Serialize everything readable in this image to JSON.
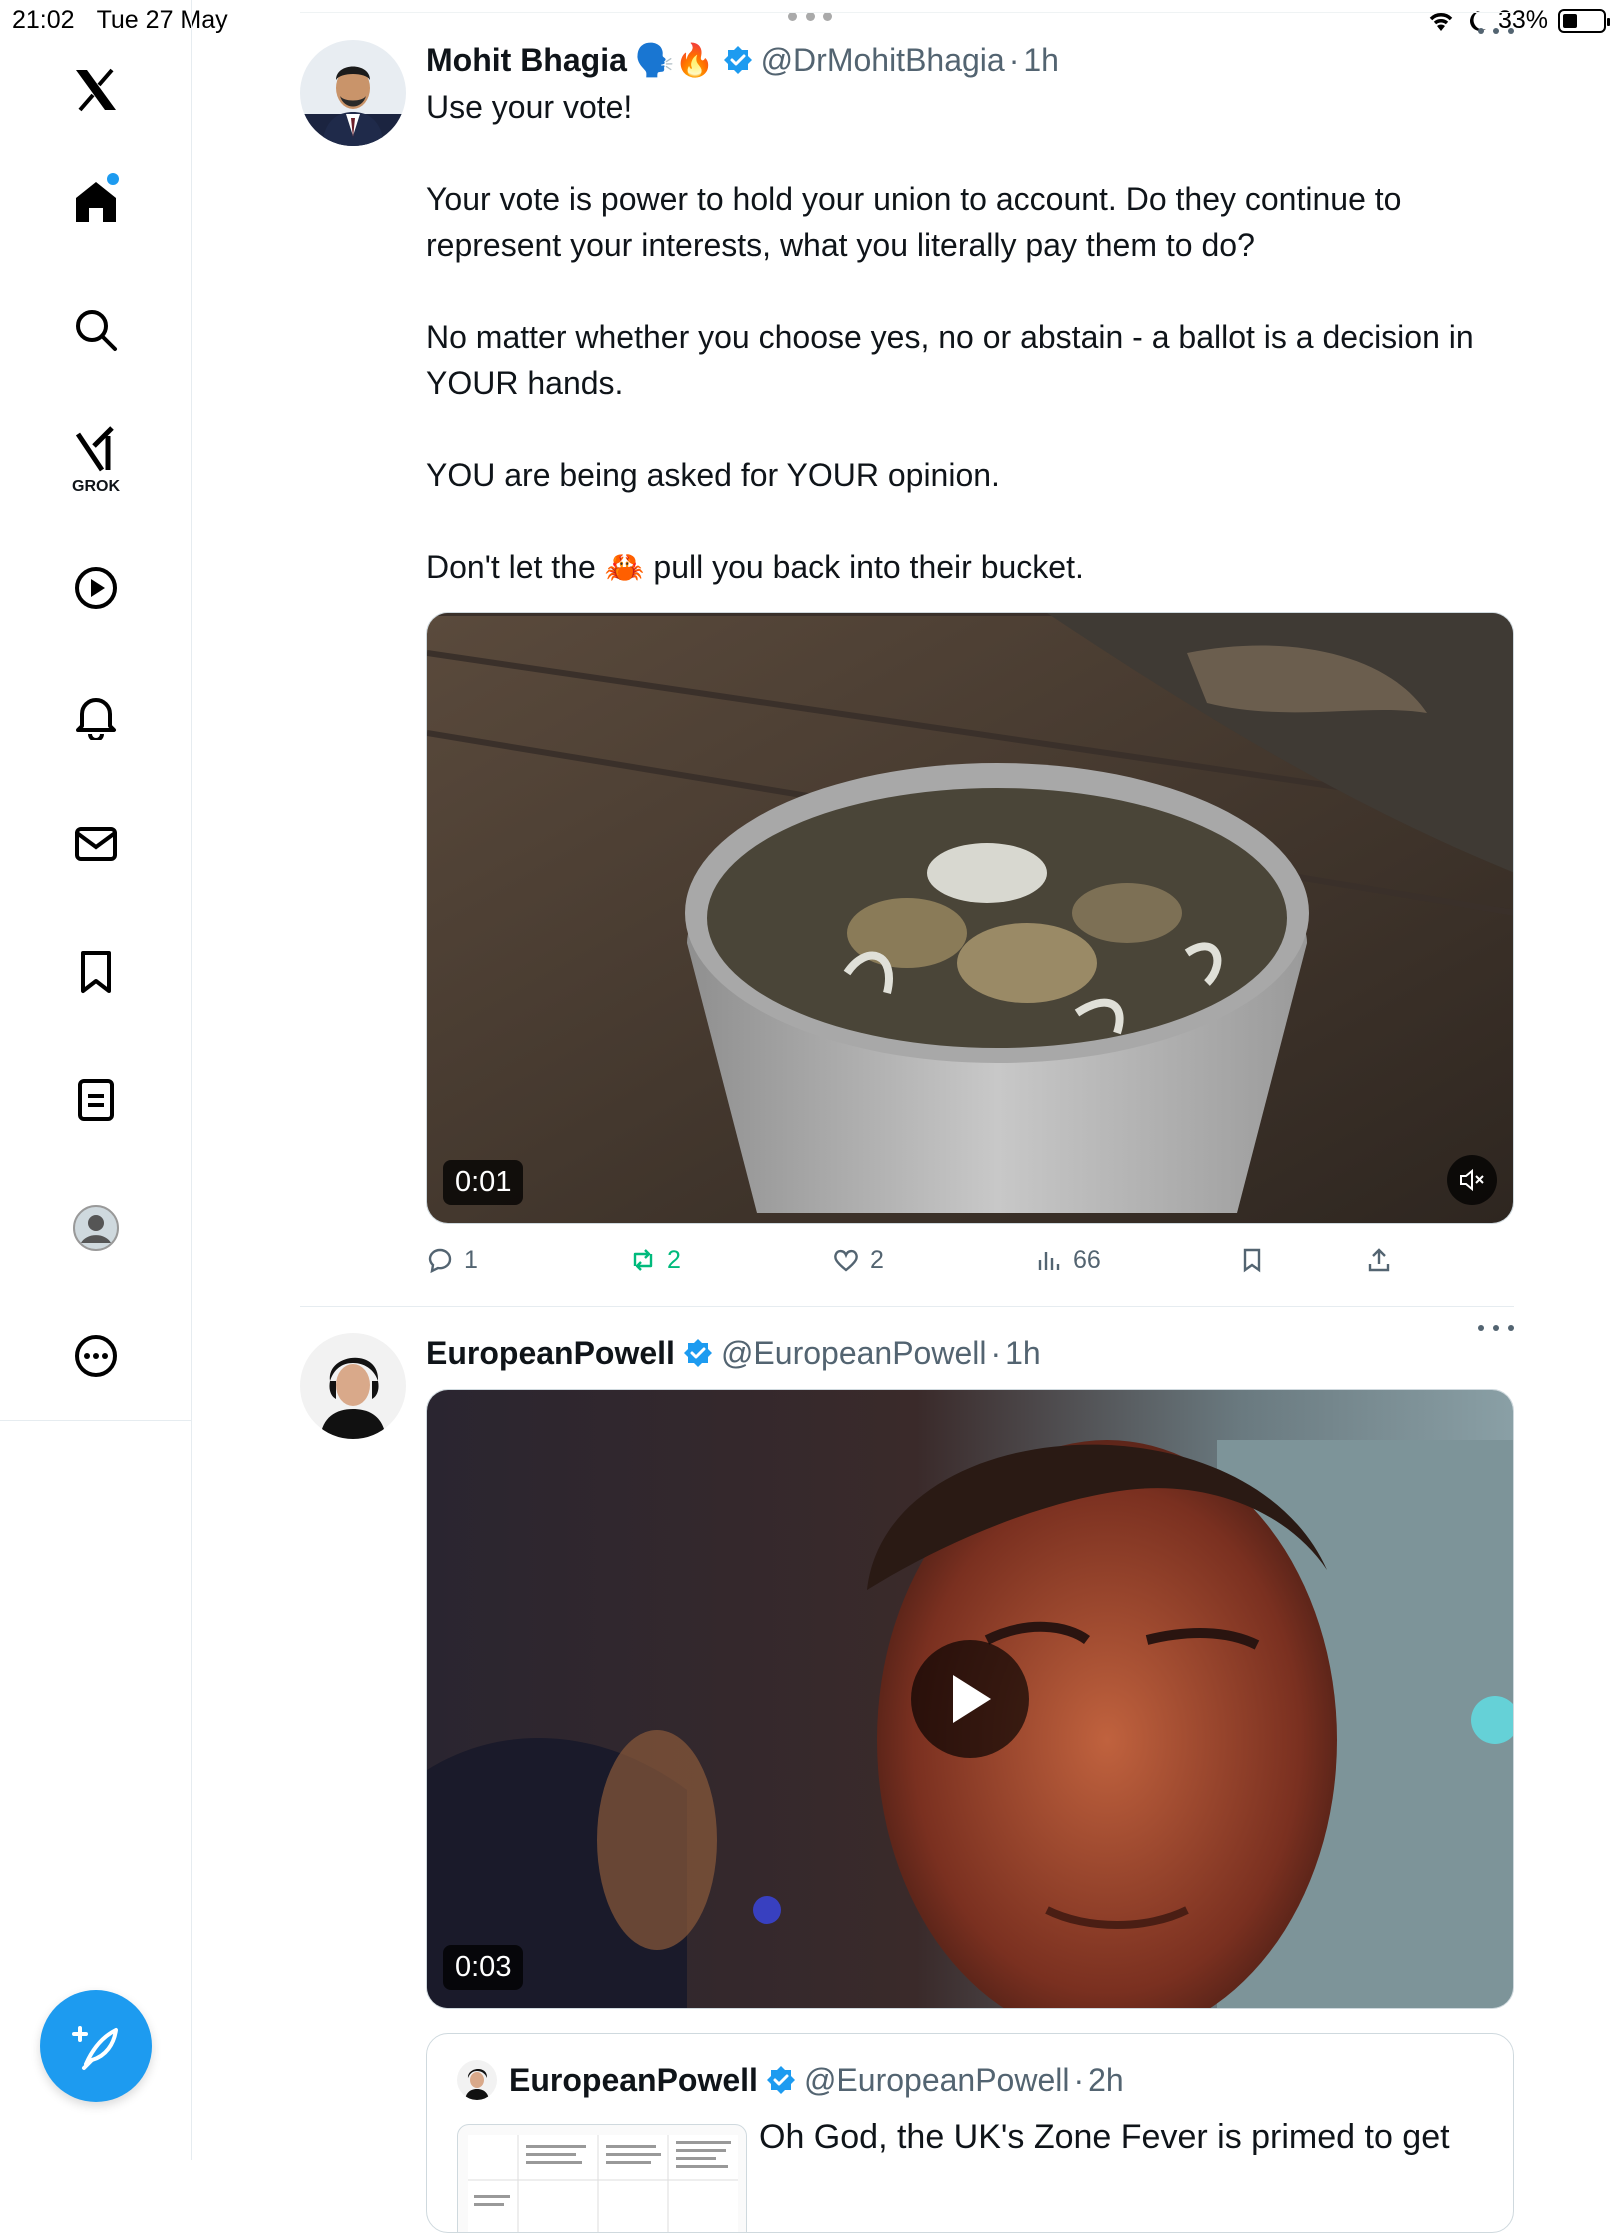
{
  "status_bar": {
    "time": "21:02",
    "date": "Tue 27 May",
    "battery": "33%"
  },
  "sidebar": {
    "grok_label": "GROK"
  },
  "tweets": [
    {
      "name": "Mohit Bhagia",
      "name_emoji": "🗣️🔥",
      "handle": "@DrMohitBhagia",
      "dot": "·",
      "age": "1h",
      "paragraphs": [
        "Use your vote!",
        "Your vote is power to hold your union to account. Do they continue to represent your interests, what you literally pay them to do?",
        "No matter whether you choose yes, no or abstain - a ballot is a decision in YOUR hands.",
        "YOU are being asked for YOUR opinion."
      ],
      "last_line_before": "Don't let the",
      "last_line_emoji": "🦀",
      "last_line_after": "pull you back into their bucket.",
      "video_duration": "0:01",
      "replies": "1",
      "reposts": "2",
      "likes": "2",
      "views": "66"
    },
    {
      "name": "EuropeanPowell",
      "handle": "@EuropeanPowell",
      "dot": "·",
      "age": "1h",
      "video_duration": "0:03",
      "quote": {
        "name": "EuropeanPowell",
        "handle": "@EuropeanPowell",
        "dot": "·",
        "age": "2h",
        "text": "Oh God, the UK's Zone Fever is primed to get"
      }
    }
  ],
  "colors": {
    "accent": "#1d9bf0",
    "repost": "#00ba7c",
    "muted": "#536471"
  }
}
